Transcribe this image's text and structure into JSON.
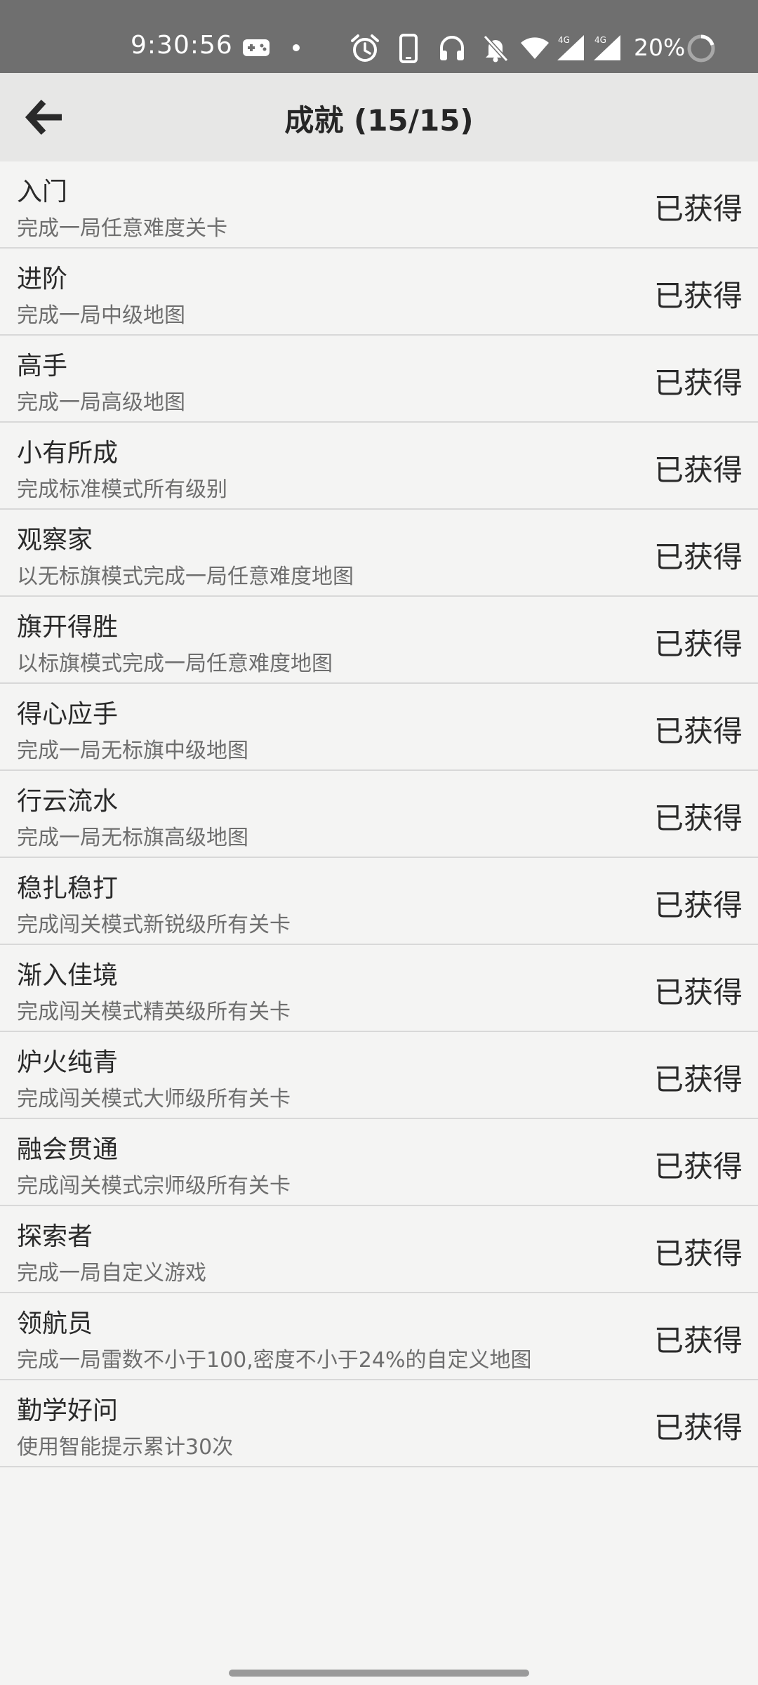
{
  "status_bar": {
    "time": "9:30:56",
    "battery_percent": "20%",
    "network_labels": [
      "4G",
      "4G"
    ],
    "icons": [
      "gamepad-icon",
      "dot-icon",
      "alarm-icon",
      "phone-icon",
      "headset-icon",
      "bell-off-icon",
      "wifi-icon",
      "signal-icon",
      "signal-icon",
      "battery-ring-icon"
    ]
  },
  "app_bar": {
    "back_icon": "arrow-left-icon",
    "title": "成就 (15/15)"
  },
  "achievements": [
    {
      "name": "入门",
      "description": "完成一局任意难度关卡",
      "status": "已获得"
    },
    {
      "name": "进阶",
      "description": "完成一局中级地图",
      "status": "已获得"
    },
    {
      "name": "高手",
      "description": "完成一局高级地图",
      "status": "已获得"
    },
    {
      "name": "小有所成",
      "description": "完成标准模式所有级别",
      "status": "已获得"
    },
    {
      "name": "观察家",
      "description": "以无标旗模式完成一局任意难度地图",
      "status": "已获得"
    },
    {
      "name": "旗开得胜",
      "description": "以标旗模式完成一局任意难度地图",
      "status": "已获得"
    },
    {
      "name": "得心应手",
      "description": "完成一局无标旗中级地图",
      "status": "已获得"
    },
    {
      "name": "行云流水",
      "description": "完成一局无标旗高级地图",
      "status": "已获得"
    },
    {
      "name": "稳扎稳打",
      "description": "完成闯关模式新锐级所有关卡",
      "status": "已获得"
    },
    {
      "name": "渐入佳境",
      "description": "完成闯关模式精英级所有关卡",
      "status": "已获得"
    },
    {
      "name": "炉火纯青",
      "description": "完成闯关模式大师级所有关卡",
      "status": "已获得"
    },
    {
      "name": "融会贯通",
      "description": "完成闯关模式宗师级所有关卡",
      "status": "已获得"
    },
    {
      "name": "探索者",
      "description": "完成一局自定义游戏",
      "status": "已获得"
    },
    {
      "name": "领航员",
      "description": "完成一局雷数不小于100,密度不小于24%的自定义地图",
      "status": "已获得"
    },
    {
      "name": "勤学好问",
      "description": "使用智能提示累计30次",
      "status": "已获得"
    }
  ],
  "colors": {
    "status_bar_bg": "#6f6f6f",
    "app_bar_bg": "#e7e7e6",
    "list_bg": "#f4f4f3",
    "divider": "#d8d8d8"
  }
}
